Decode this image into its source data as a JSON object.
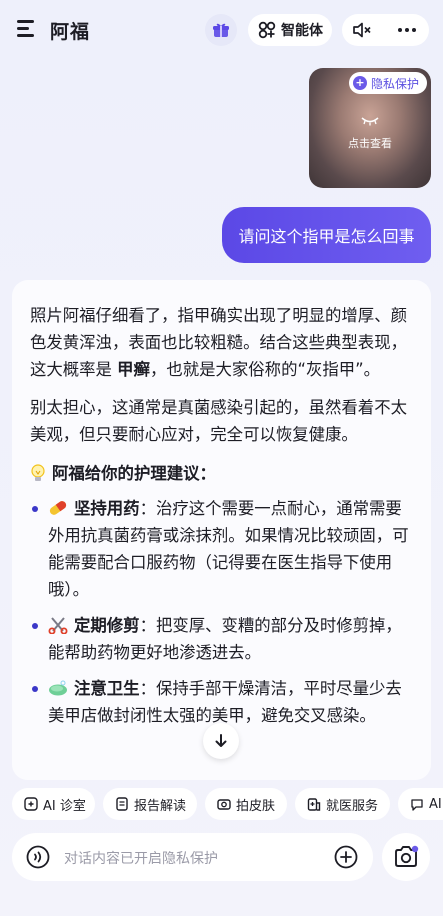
{
  "header": {
    "title": "阿福",
    "agent_label": "智能体",
    "icons": [
      "menu-icon",
      "gift-icon",
      "agent-icon",
      "mute-icon",
      "more-icon"
    ]
  },
  "photo": {
    "privacy_badge": "隐私保护",
    "view_label": "点击查看"
  },
  "user_message": "请问这个指甲是怎么回事",
  "reply": {
    "para1_a": "照片阿福仔细看了，指甲确实出现了明显的增厚、颜色发黄浑浊，表面也比较粗糙。结合这些典型表现，这大概率是 ",
    "para1_bold": "甲癣",
    "para1_b": "，也就是大家俗称的“灰指甲”。",
    "para2": "别太担心，这通常是真菌感染引起的，虽然看着不太美观，但只要耐心应对，完全可以恢复健康。",
    "tips_heading": "阿福给你的护理建议：",
    "tips": [
      {
        "title": "坚持用药",
        "text": "：治疗这个需要一点耐心，通常需要外用抗真菌药膏或涂抹剂。如果情况比较顽固，可能需要配合口服药物（记得要在医生指导下使用哦）。"
      },
      {
        "title": "定期修剪",
        "text": "：把变厚、变糟的部分及时修剪掉，能帮助药物更好地渗透进去。"
      },
      {
        "title": "注意卫生",
        "text": "：保持手部干燥清洁，平时尽量少去美甲店做封闭性太强的美甲，避免交叉感染。"
      }
    ]
  },
  "chips": [
    "AI 诊室",
    "报告解读",
    "拍皮肤",
    "就医服务",
    "AI"
  ],
  "input": {
    "placeholder": "对话内容已开启隐私保护"
  },
  "colors": {
    "accent": "#5b48e6",
    "background": "#eef0fb"
  }
}
